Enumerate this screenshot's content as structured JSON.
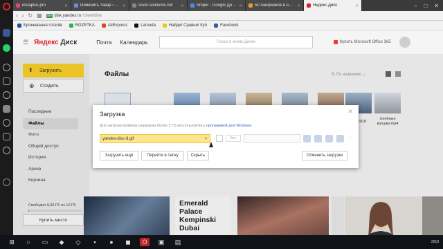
{
  "browser": {
    "tabs": [
      {
        "label": "instaplus.pro",
        "color": "#d94f6a",
        "active": false
      },
      {
        "label": "Изменить товар ‹ Video",
        "color": "#6a8fd9",
        "active": false
      },
      {
        "label": "silver-solutions.net",
        "color": "#888888",
        "active": false
      },
      {
        "label": "Sniper - Google Докумен",
        "color": "#4b8de8",
        "active": false
      },
      {
        "label": "50 лайфхаков в облаке Ян",
        "color": "#e0a12e",
        "active": false
      },
      {
        "label": "Яндекс.Диск",
        "color": "#e31e24",
        "active": true
      }
    ],
    "address": {
      "lock_label": "site",
      "host": "disk.yandex.ru",
      "path": "/client/disk"
    },
    "bookmarks": [
      {
        "label": "Бронювання готелів",
        "color": "#1e4fa1"
      },
      {
        "label": "ROZETKA",
        "color": "#30b24a"
      },
      {
        "label": "AliExpress",
        "color": "#e8412c"
      },
      {
        "label": "Lamoda",
        "color": "#111111"
      },
      {
        "label": "Найди! Сравни! Куп",
        "color": "#f0c419"
      },
      {
        "label": "Facebook",
        "color": "#3b5998"
      }
    ]
  },
  "header": {
    "logo_red": "Яндекс",
    "logo_rest": "Диск",
    "nav": [
      "Почта",
      "Календарь"
    ],
    "search_placeholder": "Поиск в моём Диске",
    "buy_office": "Купить Microsoft Office 365"
  },
  "sidebar": {
    "upload": "Загрузить",
    "create": "Создать",
    "items": [
      "Последние",
      "Файлы",
      "Фото",
      "Общий доступ",
      "История",
      "Архив",
      "Корзина"
    ],
    "selected": "Файлы",
    "quota": "Свободно 9,96 ГБ из 10 ГБ",
    "quota_used_fraction": 0.004,
    "more_space": "Купить место"
  },
  "main": {
    "title": "Файлы",
    "sort": "По названию",
    "thumb_labels": [
      "Корзина",
      "Хлебные крошки.mp4",
      "2018"
    ],
    "tile_text": [
      "Emerald",
      "Palace",
      "Kempinski",
      "Dubai"
    ]
  },
  "dialog": {
    "title": "Загрузка",
    "hint": "Для загрузки файлов размером более 2 ГБ воспользуйтесь",
    "hint_link": "программой для Windows",
    "file_name": "yandex-disc-8.gif",
    "publish_label": "Вкл",
    "buttons": {
      "upload_more": "Загрузить ещё",
      "go_folder": "Перейти в папку",
      "hide": "Скрыть",
      "cancel": "Отменить загрузки"
    }
  },
  "taskbar": {
    "time": "2018"
  }
}
